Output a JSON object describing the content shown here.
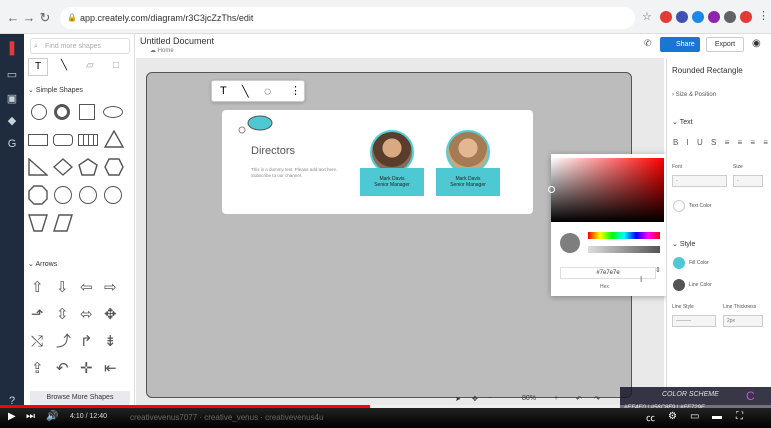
{
  "browser": {
    "url": "app.creately.com/diagram/r3C3jcZzThs/edit"
  },
  "shapes_panel": {
    "search_placeholder": "Find more shapes",
    "simple_shapes_label": "Simple Shapes",
    "arrows_label": "Arrows",
    "browse_more": "Browse More Shapes"
  },
  "document": {
    "title": "Untitled Document",
    "breadcrumb": "Home"
  },
  "header": {
    "share": "Share",
    "export": "Export"
  },
  "card": {
    "title": "Directors",
    "body": "This is a dummy text. Please add text here. Subscribe to our channel.",
    "people": [
      {
        "name": "Mark Davis",
        "role": "Senior Manager"
      },
      {
        "name": "Mark Davis",
        "role": "Senior Manager"
      }
    ]
  },
  "picker": {
    "hex": "#7e7e7e",
    "hex_label": "Hex"
  },
  "properties": {
    "shape_name": "Rounded Rectangle",
    "size_position": "Size & Position",
    "text_section": "Text",
    "font_label": "Font",
    "size_label": "Size",
    "text_color": "Text Color",
    "style_section": "Style",
    "fill_color": "Fill Color",
    "line_color": "Line Color",
    "line_style": "Line Style",
    "line_thickness": "Line Thickness",
    "thickness_value": "2px",
    "fill_hex": "#4ec9d3",
    "line_hex": "#555555"
  },
  "zoom": {
    "level": "80%"
  },
  "video": {
    "time": "4:10 / 12:40",
    "watermark": "creativevenus7077  ·  creative_venus  ·  creativevenus4u",
    "progress": 0.48,
    "scheme_title": "COLOR SCHEME",
    "scheme_codes": "#EF4E0 | #56C8F9 | #FF729F"
  }
}
